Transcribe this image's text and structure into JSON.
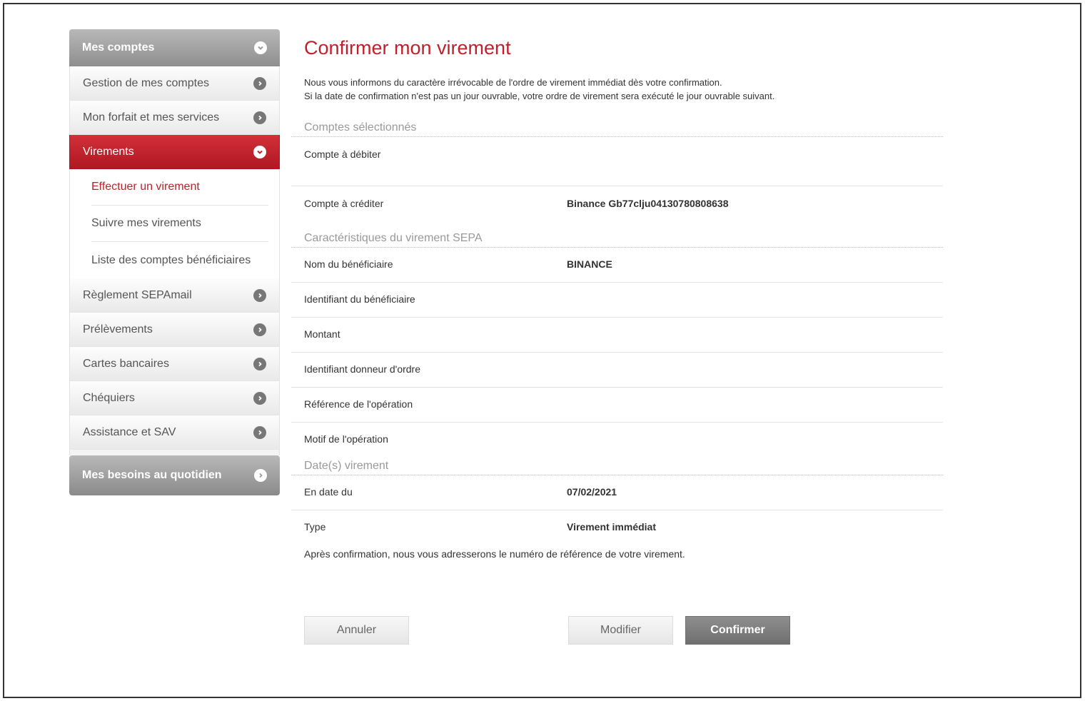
{
  "sidebar": {
    "header": "Mes comptes",
    "items": [
      {
        "label": "Gestion de mes comptes"
      },
      {
        "label": "Mon forfait et mes services"
      },
      {
        "label": "Virements"
      },
      {
        "label": "Règlement SEPAmail"
      },
      {
        "label": "Prélèvements"
      },
      {
        "label": "Cartes bancaires"
      },
      {
        "label": "Chéquiers"
      },
      {
        "label": "Assistance et SAV"
      }
    ],
    "sub_items": [
      {
        "label": "Effectuer un virement"
      },
      {
        "label": "Suivre mes virements"
      },
      {
        "label": "Liste des comptes bénéficiaires"
      }
    ],
    "bottom": "Mes besoins au quotidien"
  },
  "main": {
    "title": "Confirmer mon virement",
    "intro_line1": "Nous vous informons du caractère irrévocable de l'ordre de virement immédiat dès votre confirmation.",
    "intro_line2": "Si la date de confirmation n'est pas un jour ouvrable, votre ordre de virement sera exécuté le jour ouvrable suivant.",
    "sections": {
      "accounts": "Comptes sélectionnés",
      "sepa": "Caractéristiques du virement SEPA",
      "dates": "Date(s) virement"
    },
    "rows": {
      "debit": {
        "label": "Compte à débiter",
        "value": ""
      },
      "credit": {
        "label": "Compte à créditer",
        "value": "Binance Gb77clju04130780808638"
      },
      "beneficiary_name": {
        "label": "Nom du bénéficiaire",
        "value": "BINANCE"
      },
      "beneficiary_id": {
        "label": "Identifiant du bénéficiaire",
        "value": ""
      },
      "amount": {
        "label": "Montant",
        "value": ""
      },
      "originator_id": {
        "label": "Identifiant donneur d'ordre",
        "value": ""
      },
      "reference": {
        "label": "Référence de l'opération",
        "value": ""
      },
      "reason": {
        "label": "Motif de l'opération",
        "value": ""
      },
      "date": {
        "label": "En date du",
        "value": "07/02/2021"
      },
      "type": {
        "label": "Type",
        "value": "Virement immédiat"
      }
    },
    "note": "Après confirmation, nous vous adresserons le numéro de référence de votre virement.",
    "buttons": {
      "cancel": "Annuler",
      "modify": "Modifier",
      "confirm": "Confirmer"
    }
  },
  "colors": {
    "accent": "#c0202a",
    "sidebar_header": "#9e9e9e"
  }
}
